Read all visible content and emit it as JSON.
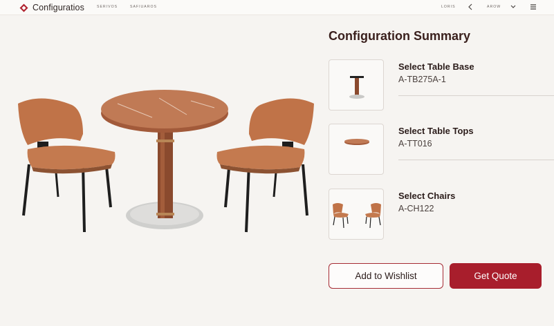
{
  "app": {
    "brand_name": "Configuratios",
    "nav": [
      "SERIVOS",
      "SAFIUAROS"
    ],
    "top_right": {
      "login": "LORIS",
      "back_icon": "chevron-left-icon",
      "account": "AROW",
      "dropdown_icon": "chevron-down-icon",
      "menu_icon": "hamburger-menu-icon"
    }
  },
  "summary": {
    "title": "Configuration Summary",
    "items": [
      {
        "title": "Select Table Base",
        "code": "A-TB275A-1",
        "thumb": "table-base-thumbnail"
      },
      {
        "title": "Select Table Tops",
        "code": "A-TT016",
        "thumb": "table-top-thumbnail"
      },
      {
        "title": "Select Chairs",
        "code": "A-CH122",
        "thumb": "chairs-thumbnail"
      }
    ]
  },
  "actions": {
    "wishlist_label": "Add to Wishlist",
    "quote_label": "Get Quote"
  },
  "colors": {
    "accent": "#a81e2c",
    "leather": "#c47a4f",
    "wood": "#8a4a2e",
    "steel": "#c9c9c7",
    "background": "#f6f4f1"
  }
}
